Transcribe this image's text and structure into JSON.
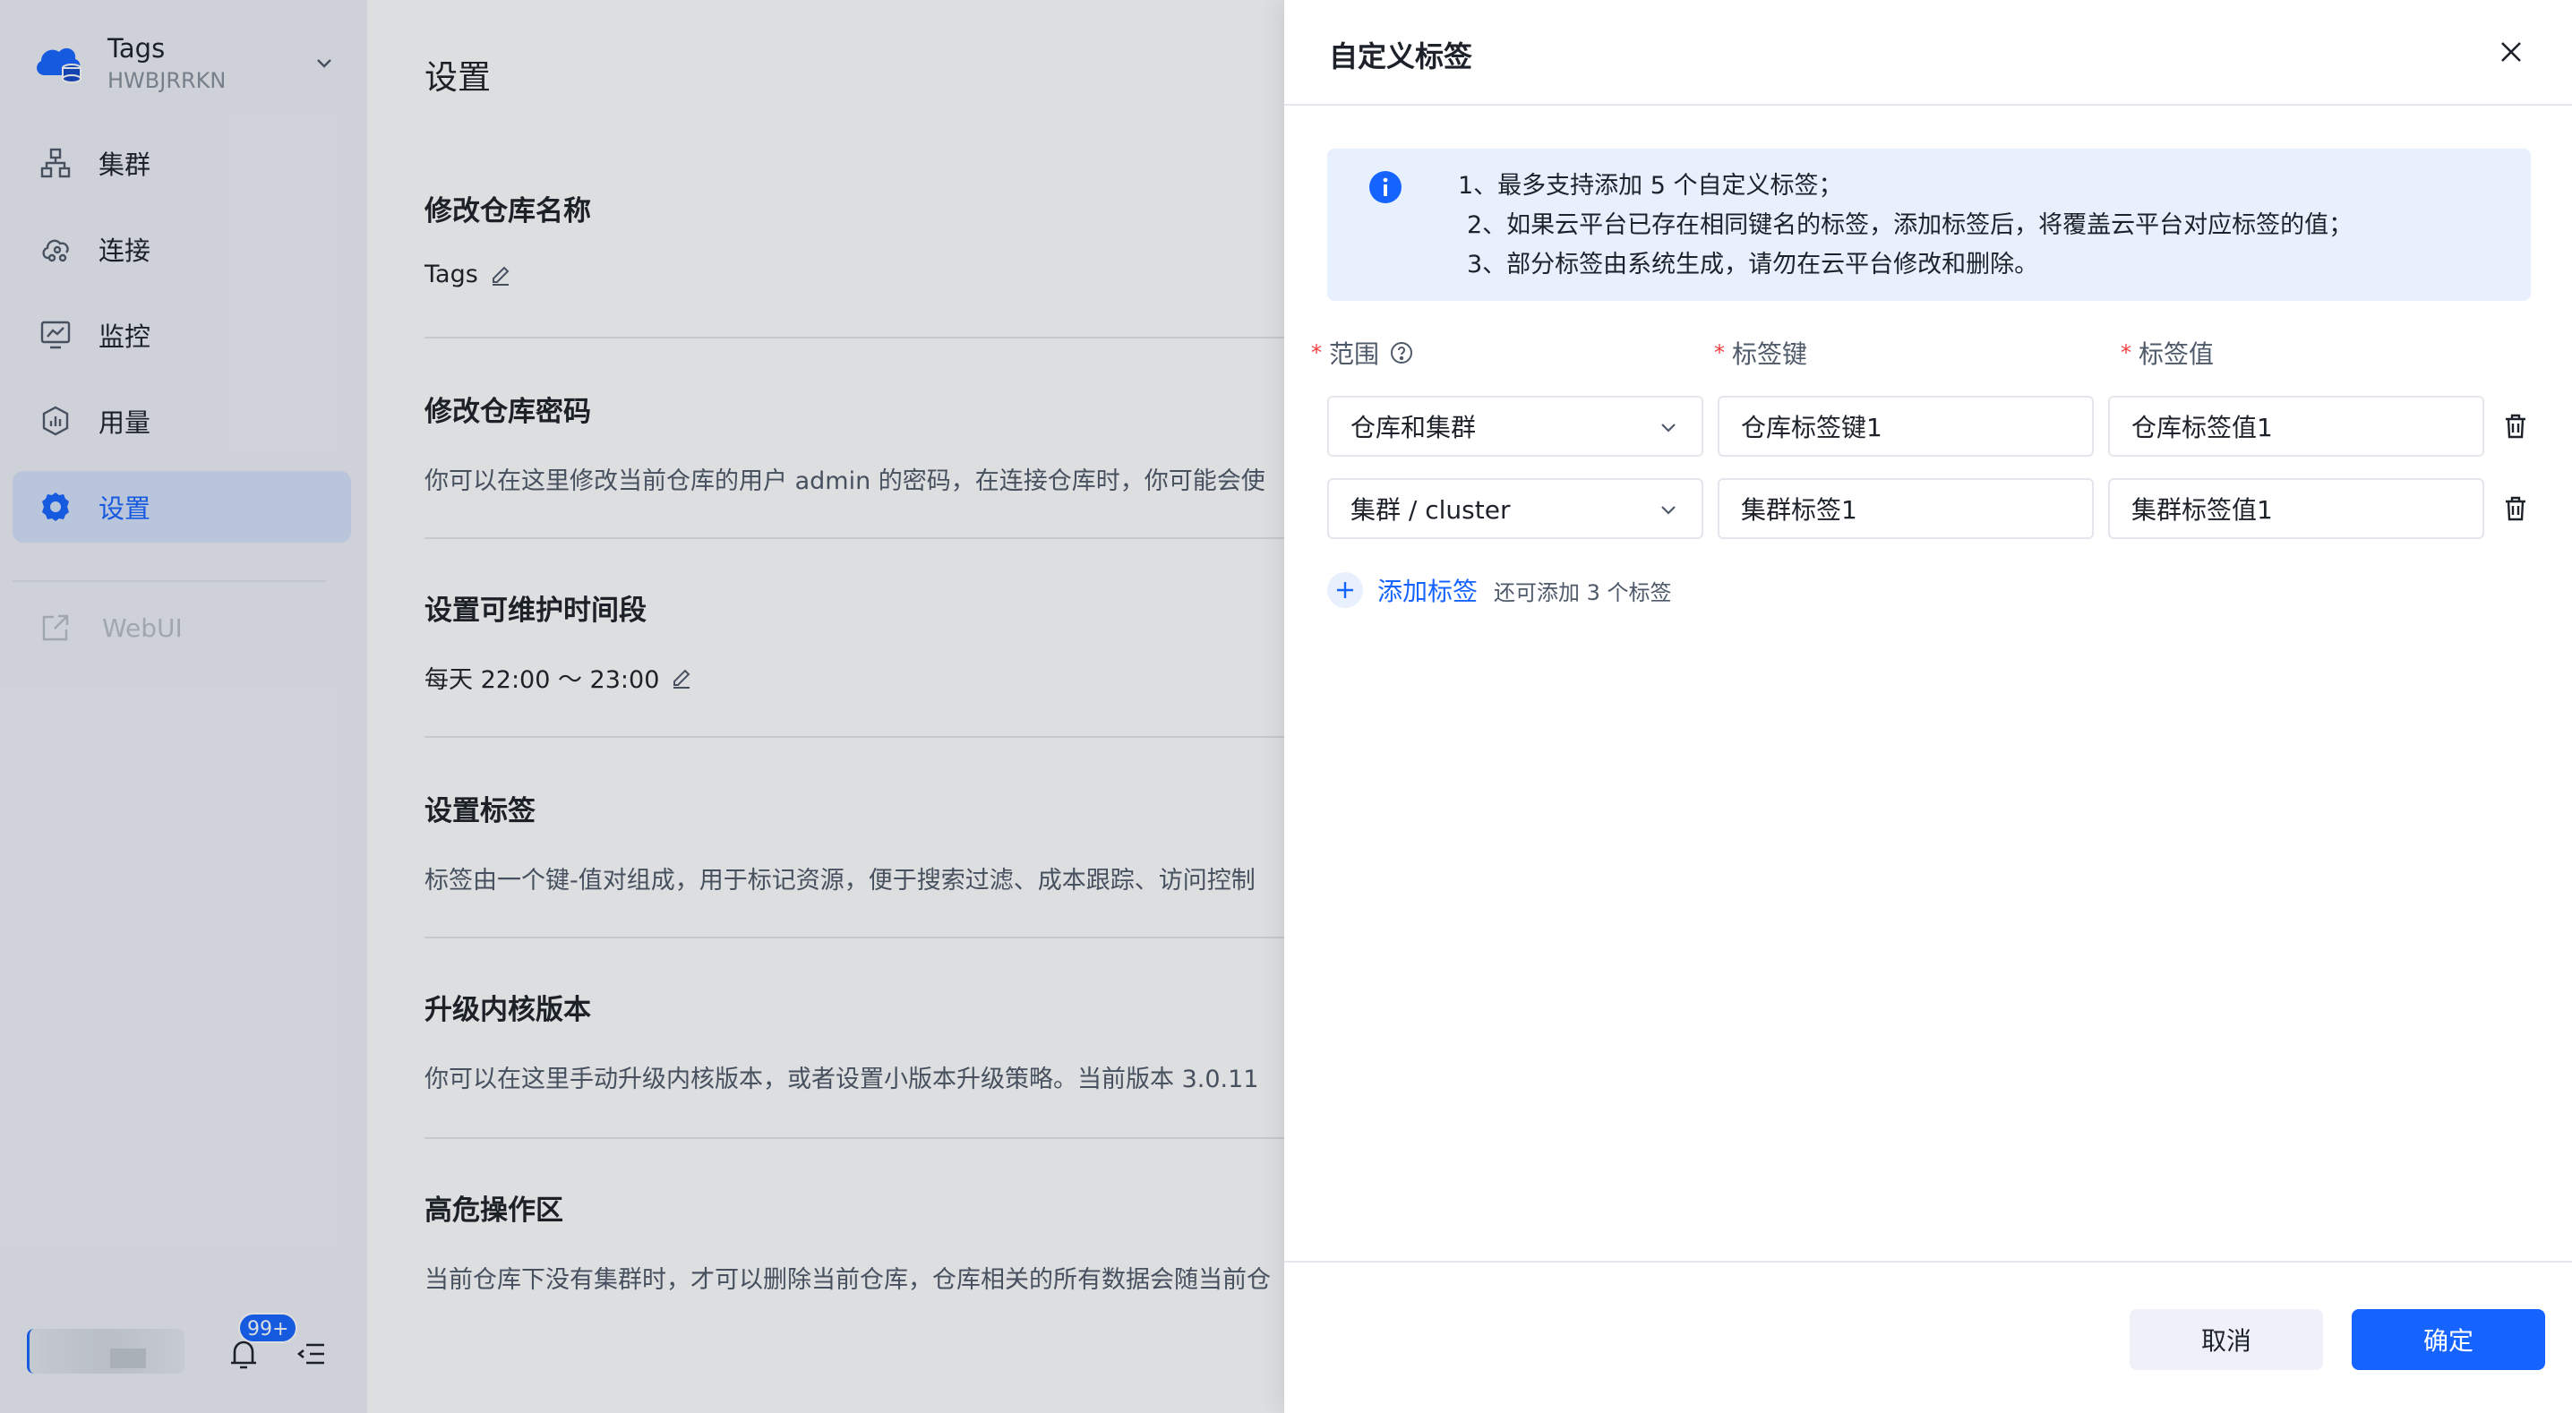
{
  "workspace": {
    "title": "Tags",
    "subtitle": "HWBJRRKN"
  },
  "sidebar": {
    "items": [
      {
        "label": "集群",
        "icon": "cluster-icon",
        "active": false
      },
      {
        "label": "连接",
        "icon": "connection-icon",
        "active": false
      },
      {
        "label": "监控",
        "icon": "monitor-icon",
        "active": false
      },
      {
        "label": "用量",
        "icon": "usage-icon",
        "active": false
      },
      {
        "label": "设置",
        "icon": "gear-icon",
        "active": true
      }
    ],
    "webui_label": "WebUI",
    "notification_badge": "99+"
  },
  "main": {
    "page_title": "设置",
    "sections": [
      {
        "title": "修改仓库名称",
        "value": "Tags"
      },
      {
        "title": "修改仓库密码",
        "desc": "你可以在这里修改当前仓库的用户 admin 的密码，在连接仓库时，你可能会使"
      },
      {
        "title": "设置可维护时间段",
        "value": "每天 22:00 ～ 23:00"
      },
      {
        "title": "设置标签",
        "desc": "标签由一个键-值对组成，用于标记资源，便于搜索过滤、成本跟踪、访问控制"
      },
      {
        "title": "升级内核版本",
        "desc": "你可以在这里手动升级内核版本，或者设置小版本升级策略。当前版本 3.0.11"
      },
      {
        "title": "高危操作区",
        "desc": "当前仓库下没有集群时，才可以删除当前仓库，仓库相关的所有数据会随当前仓"
      }
    ]
  },
  "drawer": {
    "title": "自定义标签",
    "info": [
      "1、最多支持添加 5 个自定义标签；",
      "2、如果云平台已存在相同键名的标签，添加标签后，将覆盖云平台对应标签的值；",
      "3、部分标签由系统生成，请勿在云平台修改和删除。"
    ],
    "columns": {
      "scope": "范围",
      "key": "标签键",
      "value": "标签值"
    },
    "rows": [
      {
        "scope": "仓库和集群",
        "key": "仓库标签键1",
        "value": "仓库标签值1"
      },
      {
        "scope": "集群 / cluster",
        "key": "集群标签1",
        "value": "集群标签值1"
      }
    ],
    "add_label": "添加标签",
    "add_hint": "还可添加 3 个标签",
    "cancel_label": "取消",
    "ok_label": "确定"
  },
  "colors": {
    "accent": "#1664ff",
    "sidebar_bg": "#eef1f7",
    "info_bg": "#e8f0fd",
    "required": "#f53f3f"
  }
}
